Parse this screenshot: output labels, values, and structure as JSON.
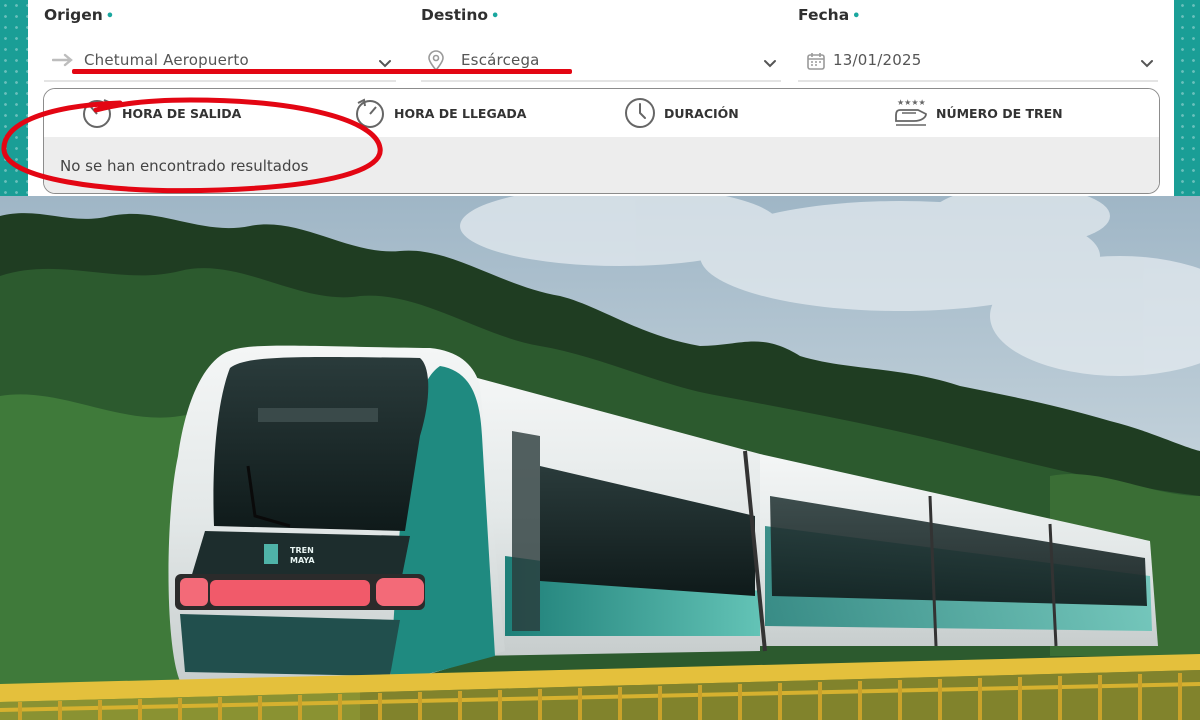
{
  "search": {
    "origen": {
      "label": "Origen",
      "required_mark": "•",
      "value": "Chetumal Aeropuerto"
    },
    "destino": {
      "label": "Destino",
      "required_mark": "•",
      "value": "Escárcega"
    },
    "fecha": {
      "label": "Fecha",
      "required_mark": "•",
      "value": "13/01/2025"
    }
  },
  "results": {
    "columns": [
      {
        "label": "HORA DE SALIDA",
        "icon": "departure-clock-icon"
      },
      {
        "label": "HORA DE LLEGADA",
        "icon": "arrival-clock-icon"
      },
      {
        "label": "DURACIÓN",
        "icon": "clock-icon"
      },
      {
        "label": "NÚMERO DE TREN",
        "icon": "train-icon"
      }
    ],
    "empty_message": "No se han encontrado resultados"
  },
  "photo": {
    "train_logo_text": [
      "TREN",
      "MAYA"
    ]
  },
  "colors": {
    "accent_teal": "#1aa79f",
    "annotation_red": "#e30613"
  }
}
